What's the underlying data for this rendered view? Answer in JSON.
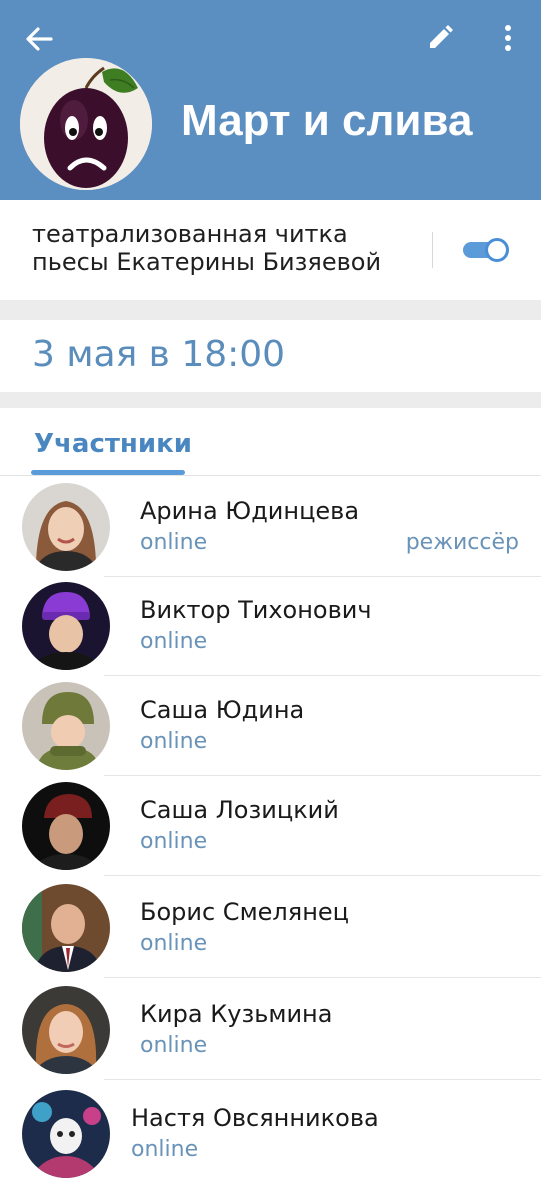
{
  "header": {
    "title": "Март и слива",
    "back_icon": "arrow-left-icon",
    "edit_icon": "pencil-icon",
    "menu_icon": "more-vertical-icon",
    "background_color": "#5b8ec1"
  },
  "description": {
    "line1": "театрализованная читка",
    "line2": "пьесы Екатерины  Бизяевой",
    "toggle_on": true
  },
  "event": {
    "date": "3 мая в 18:00"
  },
  "members_tab": {
    "label": "Участники",
    "accent_color": "#5b9bd9"
  },
  "members": [
    {
      "name": "Арина Юдинцева",
      "status": "online",
      "role": "режиссёр"
    },
    {
      "name": "Виктор Тихонович",
      "status": "online"
    },
    {
      "name": "Саша Юдина",
      "status": "online"
    },
    {
      "name": "Саша Лозицкий",
      "status": "online"
    },
    {
      "name": "Борис Смелянец",
      "status": "online"
    },
    {
      "name": "Кира Кузьмина",
      "status": "online"
    },
    {
      "name": "Настя Овсянникова",
      "status": "online"
    }
  ]
}
